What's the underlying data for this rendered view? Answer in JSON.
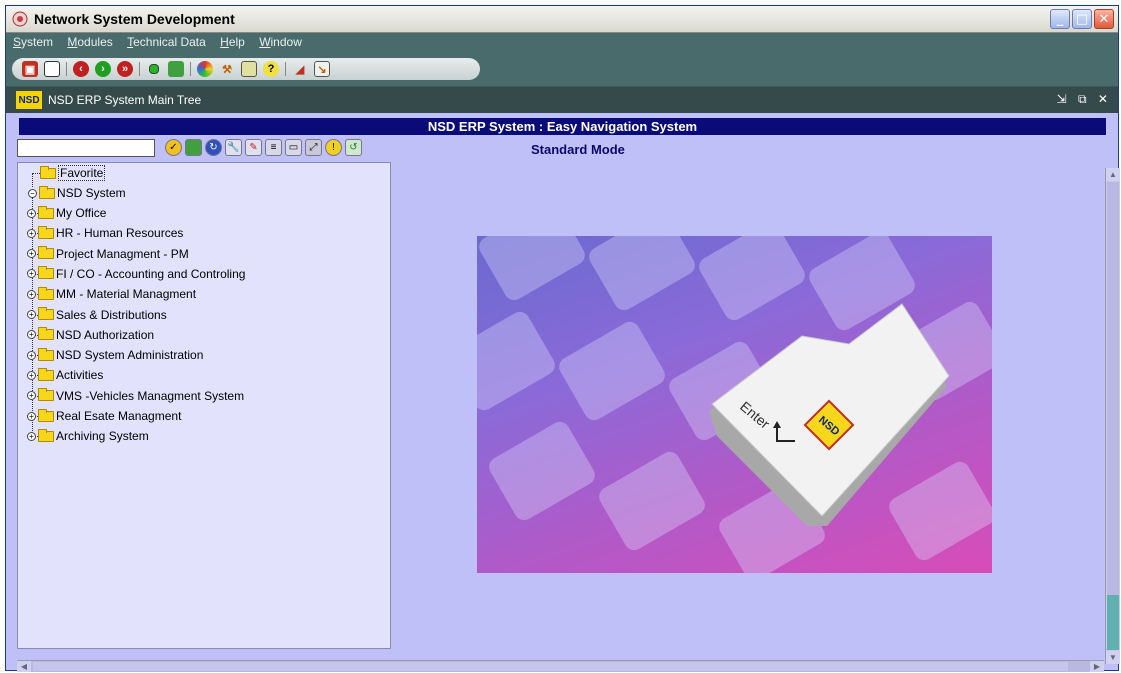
{
  "window": {
    "title": "Network System Development",
    "minimize_glyph": "_",
    "maximize_glyph": "□",
    "close_glyph": "✕"
  },
  "menu": [
    {
      "label": "System",
      "mnemonic": "S"
    },
    {
      "label": "Modules",
      "mnemonic": "M"
    },
    {
      "label": "Technical Data",
      "mnemonic": "T"
    },
    {
      "label": "Help",
      "mnemonic": "H"
    },
    {
      "label": "Window",
      "mnemonic": "W"
    }
  ],
  "subwindow": {
    "logo": "NSD",
    "title": "NSD ERP System Main Tree",
    "controls": "⇲ ⧉ ✕"
  },
  "banner": "NSD ERP System : Easy Navigation System",
  "mode": "Standard Mode",
  "search": {
    "value": "",
    "placeholder": ""
  },
  "tree": {
    "favorite": "Favorite",
    "root": "NSD  System",
    "expand_glyph": "+",
    "collapse_glyph": "−",
    "items": [
      "My Office",
      "HR - Human Resources",
      "Project Managment - PM",
      "FI / CO - Accounting and Controling",
      "MM - Material Managment",
      "Sales & Distributions",
      "NSD Authorization",
      "NSD System Administration",
      "Activities",
      "VMS -Vehicles Managment System",
      "Real  Esate Managment",
      "Archiving System"
    ]
  },
  "hero": {
    "key_text": "Enter",
    "badge": "NSD"
  },
  "colors": {
    "background": "#c0c0f8",
    "banner": "#0a0a78",
    "menubar": "#4a6b6b"
  },
  "icons": {
    "toolbar": [
      "save-icon",
      "new-icon",
      "record-prev-icon",
      "record-next-icon",
      "record-last-icon",
      "run-icon",
      "query-icon",
      "colors-icon",
      "tools-icon",
      "calculator-icon",
      "help-icon",
      "print-icon",
      "exit-icon"
    ],
    "tree_tools": [
      "check-icon",
      "image-icon",
      "refresh-icon",
      "wrench-icon",
      "edit-icon",
      "list-icon",
      "window-icon",
      "expand-icon",
      "warning-icon",
      "reload-icon"
    ]
  }
}
